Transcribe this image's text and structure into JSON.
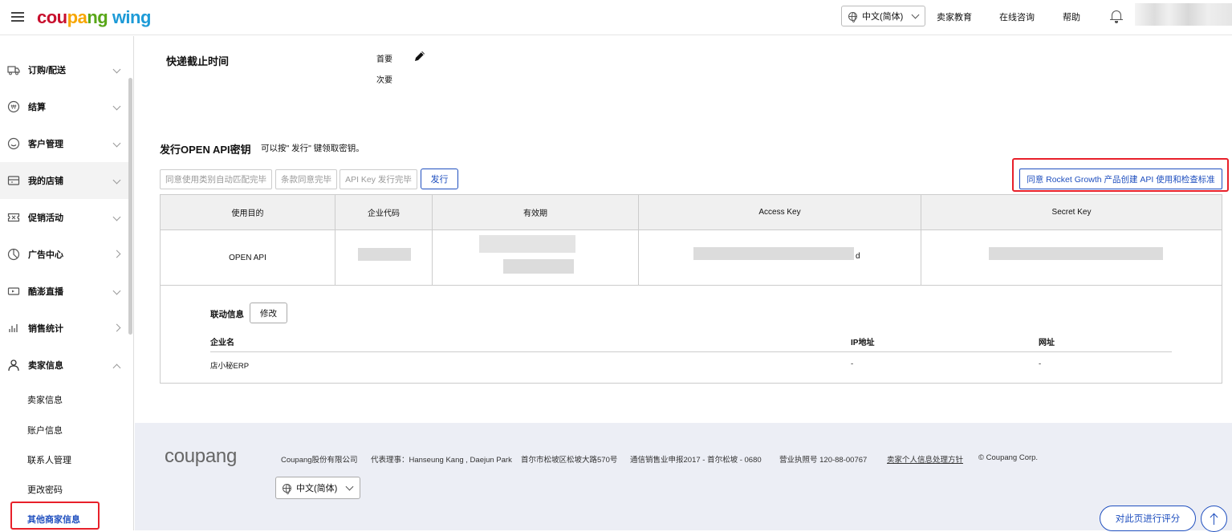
{
  "header": {
    "logo_parts": [
      "cou",
      "pa",
      "ng",
      " wing"
    ],
    "language": "中文(简体)",
    "links": [
      "卖家教育",
      "在线咨询",
      "帮助"
    ]
  },
  "sidebar": {
    "items": [
      {
        "label": "订购/配送",
        "icon": "truck-icon"
      },
      {
        "label": "结算",
        "icon": "won-coin-icon"
      },
      {
        "label": "客户管理",
        "icon": "smile-icon"
      },
      {
        "label": "我的店铺",
        "icon": "store-icon"
      },
      {
        "label": "促销活动",
        "icon": "coupon-icon"
      },
      {
        "label": "广告中心",
        "icon": "chart-pie-icon"
      },
      {
        "label": "酷澎直播",
        "icon": "live-icon"
      },
      {
        "label": "销售统计",
        "icon": "bar-chart-icon"
      },
      {
        "label": "卖家信息",
        "icon": "user-icon"
      }
    ],
    "sub_items": [
      "卖家信息",
      "账户信息",
      "联系人管理",
      "更改密码",
      "其他商家信息"
    ]
  },
  "main": {
    "cutoff_title": "快递截止时间",
    "primary_label": "首要",
    "secondary_label": "次要",
    "api_title": "发行OPEN API密钥",
    "api_hint": "可以按\" 发行\" 键领取密钥。",
    "steps": [
      "同意使用类别自动匹配完毕",
      "条款同意完毕",
      "API Key 发行完毕"
    ],
    "issue_button": "发行",
    "rocket_button": "同意 Rocket Growth 产品创建 API 使用和检查标准",
    "table": {
      "headers": [
        "使用目的",
        "企业代码",
        "有效期",
        "Access Key",
        "Secret Key"
      ],
      "row": {
        "purpose": "OPEN API",
        "access_key_tail": "d"
      }
    },
    "link_info": {
      "title": "联动信息",
      "edit_button": "修改",
      "headers": [
        "企业名",
        "IP地址",
        "网址"
      ],
      "row": [
        "店小秘ERP",
        "-",
        "-"
      ]
    }
  },
  "footer": {
    "logo": "coupang",
    "company": "Coupang股份有限公司",
    "ceo": "代表理事：Hanseung Kang , Daejun Park",
    "address": "首尔市松坡区松坡大路570号",
    "telecom": "通信销售业申报2017 - 首尔松坡 - 0680",
    "biz_no": "营业执照号 120-88-00767",
    "privacy": "卖家个人信息处理方针",
    "copyright": "© Coupang Corp.",
    "language": "中文(简体)",
    "rate_button": "对此页进行评分"
  },
  "colors": {
    "accent": "#1f4fbf",
    "highlight": "#e8202a",
    "footer_bg": "#eceef5"
  }
}
